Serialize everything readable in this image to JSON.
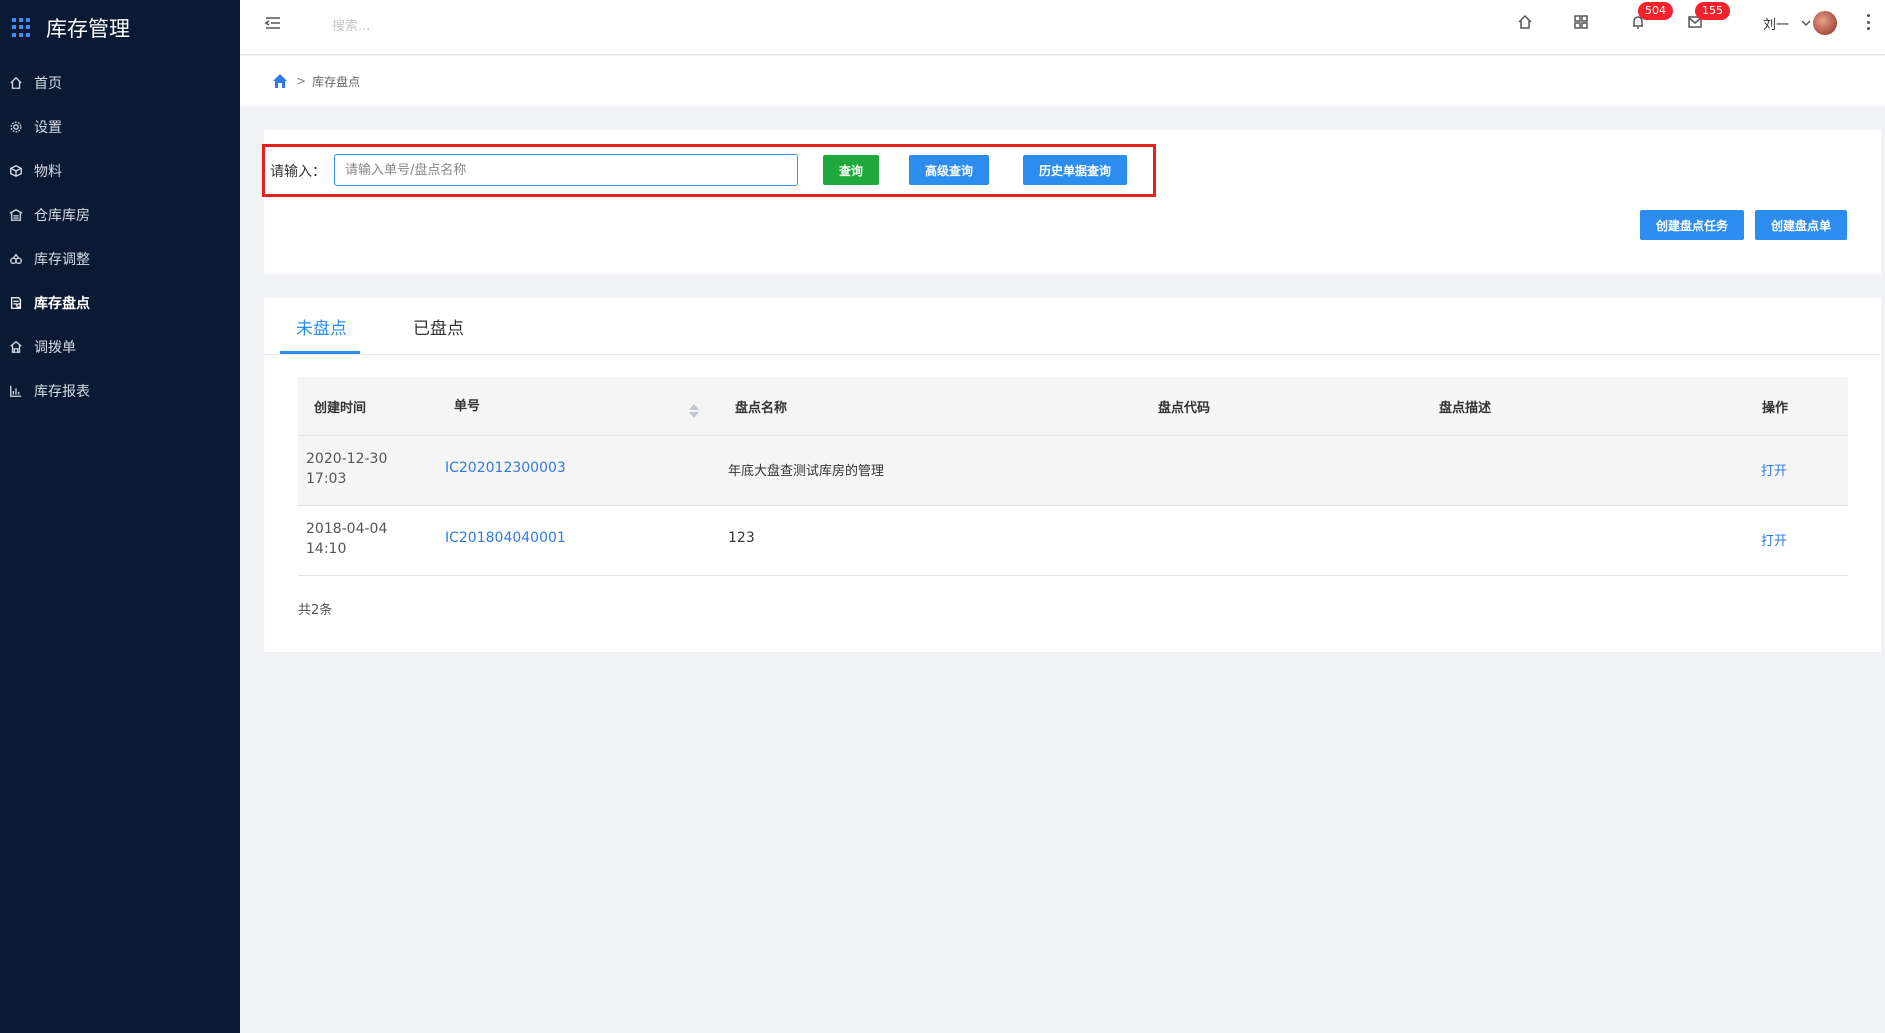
{
  "sidebar": {
    "title": "库存管理",
    "items": [
      {
        "label": "首页",
        "icon": "home-icon"
      },
      {
        "label": "设置",
        "icon": "settings-icon"
      },
      {
        "label": "物料",
        "icon": "box-icon"
      },
      {
        "label": "仓库库房",
        "icon": "warehouse-icon"
      },
      {
        "label": "库存调整",
        "icon": "adjust-icon"
      },
      {
        "label": "库存盘点",
        "icon": "inventory-check-icon",
        "active": true
      },
      {
        "label": "调拨单",
        "icon": "transfer-icon"
      },
      {
        "label": "库存报表",
        "icon": "bar-chart-icon"
      }
    ]
  },
  "header": {
    "search_placeholder": "搜索...",
    "notifications_badge": "504",
    "messages_badge": "155",
    "user_name": "刘一"
  },
  "breadcrumb": {
    "current": "库存盘点"
  },
  "search_panel": {
    "label": "请输入：",
    "input_placeholder": "请输入单号/盘点名称",
    "query_button": "查询",
    "advanced_button": "高级查询",
    "history_button": "历史单据查询",
    "create_task_button": "创建盘点任务",
    "create_sheet_button": "创建盘点单"
  },
  "tabs": [
    {
      "label": "未盘点",
      "active": true
    },
    {
      "label": "已盘点",
      "active": false
    }
  ],
  "table": {
    "columns": [
      "创建时间",
      "单号",
      "盘点名称",
      "盘点代码",
      "盘点描述",
      "操作"
    ],
    "rows": [
      {
        "created_date": "2020-12-30",
        "created_time": "17:03",
        "number": "IC202012300003",
        "name": "年底大盘查测试库房的管理",
        "code": "",
        "desc": "",
        "action": "打开"
      },
      {
        "created_date": "2018-04-04",
        "created_time": "14:10",
        "number": "IC201804040001",
        "name": "123",
        "code": "",
        "desc": "",
        "action": "打开"
      }
    ],
    "total": "共2条"
  },
  "colors": {
    "sidebar_bg": "#0b1a33",
    "primary": "#2d8cf0",
    "success": "#1fa93c",
    "danger": "#f5222d",
    "highlight": "#e5201d"
  }
}
